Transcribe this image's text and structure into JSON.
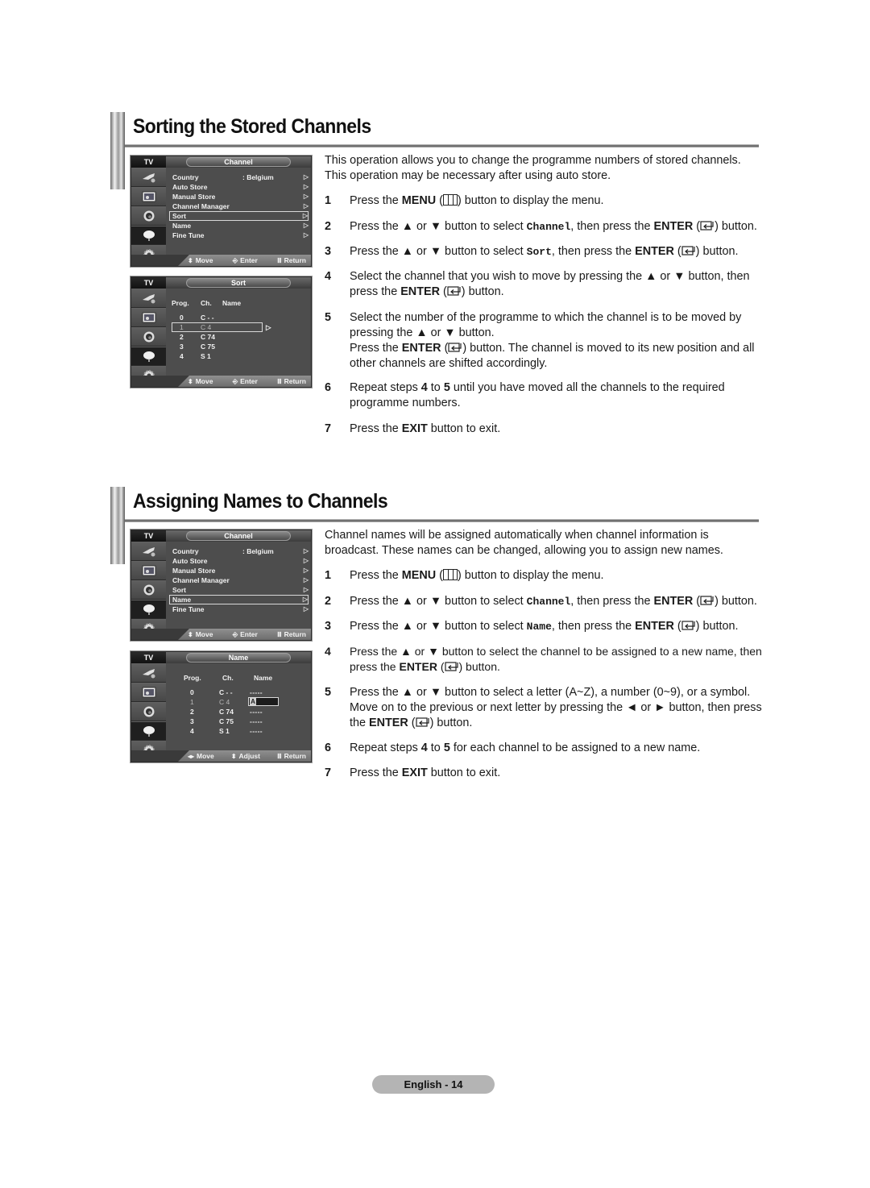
{
  "sections": [
    {
      "title": "Sorting the Stored Channels",
      "osd_channel_menu": {
        "tv_label": "TV",
        "title": "Channel",
        "items": [
          {
            "label": "Country",
            "value": ": Belgium"
          },
          {
            "label": "Auto Store",
            "value": ""
          },
          {
            "label": "Manual Store",
            "value": ""
          },
          {
            "label": "Channel Manager",
            "value": ""
          },
          {
            "label": "Sort",
            "value": "",
            "selected": true
          },
          {
            "label": "Name",
            "value": ""
          },
          {
            "label": "Fine Tune",
            "value": ""
          }
        ],
        "footer": [
          "Move",
          "Enter",
          "Return"
        ]
      },
      "osd_sub": {
        "tv_label": "TV",
        "title": "Sort",
        "headers": [
          "Prog.",
          "Ch.",
          "Name"
        ],
        "rows": [
          {
            "prog": "0",
            "ch": "C - -"
          },
          {
            "prog": "1",
            "ch": "C 4",
            "selected": true
          },
          {
            "prog": "2",
            "ch": "C 74"
          },
          {
            "prog": "3",
            "ch": "C 75"
          },
          {
            "prog": "4",
            "ch": "S 1"
          }
        ],
        "footer": [
          "Move",
          "Enter",
          "Return"
        ]
      },
      "intro": "This operation allows you to change the programme numbers of stored channels. This operation may be necessary after using auto store.",
      "steps": [
        {
          "num": "1",
          "parts": [
            "Press the ",
            "MENU",
            " (",
            ") button to display the menu."
          ]
        },
        {
          "num": "2",
          "parts": [
            "Press the ▲ or ▼ button to select ",
            "Channel",
            ", then press the ",
            "ENTER",
            " (",
            ") button."
          ]
        },
        {
          "num": "3",
          "parts": [
            "Press the ▲ or ▼ button to select ",
            "Sort",
            ", then press the ",
            "ENTER",
            " (",
            ") button."
          ]
        },
        {
          "num": "4",
          "parts": [
            "Select the channel that you wish to move by pressing the ▲ or ▼ button, then press the ",
            "ENTER",
            " (",
            ") button."
          ]
        },
        {
          "num": "5",
          "parts": [
            "Select the number of the programme to which the channel is to be moved by pressing the ▲ or ▼ button.",
            "Press the ",
            "ENTER",
            " (",
            ") button. The channel is moved to its new position and all other channels are shifted accordingly."
          ]
        },
        {
          "num": "6",
          "parts": [
            "Repeat steps ",
            "4",
            " to ",
            "5",
            " until you have moved all the channels to the required programme numbers."
          ]
        },
        {
          "num": "7",
          "parts": [
            "Press the ",
            "EXIT",
            " button to exit."
          ]
        }
      ]
    },
    {
      "title": "Assigning Names to Channels",
      "osd_channel_menu": {
        "tv_label": "TV",
        "title": "Channel",
        "items": [
          {
            "label": "Country",
            "value": ": Belgium"
          },
          {
            "label": "Auto Store",
            "value": ""
          },
          {
            "label": "Manual Store",
            "value": ""
          },
          {
            "label": "Channel Manager",
            "value": ""
          },
          {
            "label": "Sort",
            "value": ""
          },
          {
            "label": "Name",
            "value": "",
            "selected": true
          },
          {
            "label": "Fine Tune",
            "value": ""
          }
        ],
        "footer": [
          "Move",
          "Enter",
          "Return"
        ]
      },
      "osd_sub": {
        "tv_label": "TV",
        "title": "Name",
        "headers": [
          "Prog.",
          "Ch.",
          "Name"
        ],
        "rows": [
          {
            "prog": "0",
            "ch": "C - -",
            "name": "- - - - -"
          },
          {
            "prog": "1",
            "ch": "C 4",
            "name": "A",
            "selected": true
          },
          {
            "prog": "2",
            "ch": "C 74",
            "name": "- - - - -"
          },
          {
            "prog": "3",
            "ch": "C 75",
            "name": "- - - - -"
          },
          {
            "prog": "4",
            "ch": "S 1",
            "name": "- - - - -"
          }
        ],
        "footer": [
          "Move",
          "Adjust",
          "Return"
        ]
      },
      "intro": "Channel names will be assigned automatically when channel information is broadcast. These names can be changed, allowing you to assign new names.",
      "steps": [
        {
          "num": "1",
          "parts": [
            "Press the ",
            "MENU",
            " (",
            ") button to display the menu."
          ]
        },
        {
          "num": "2",
          "parts": [
            "Press the ▲ or ▼ button to select ",
            "Channel",
            ", then press the ",
            "ENTER",
            " (",
            ") button."
          ]
        },
        {
          "num": "3",
          "parts": [
            "Press the ▲ or ▼ button to select ",
            "Name",
            ", then press the ",
            "ENTER",
            " (",
            ") button."
          ]
        },
        {
          "num": "4",
          "parts": [
            "Press the ▲ or ▼ button to select the channel to be assigned to a new name, then press the ",
            "ENTER",
            " (",
            ") button."
          ]
        },
        {
          "num": "5",
          "parts": [
            "Press the ▲ or ▼ button to select a letter (A~Z), a number (0~9), or a symbol. Move on to the previous or next letter by pressing the ◄ or ► button, then press the ",
            "ENTER",
            " (",
            ") button."
          ]
        },
        {
          "num": "6",
          "parts": [
            "Repeat steps ",
            "4",
            " to ",
            "5",
            " for each channel to be assigned to a new name."
          ]
        },
        {
          "num": "7",
          "parts": [
            "Press the ",
            "EXIT",
            " button to exit."
          ]
        }
      ]
    }
  ],
  "icons": {
    "menu_sidebar": [
      "input-plug-icon",
      "picture-icon",
      "sound-icon",
      "channel-dish-icon",
      "setup-gear-icon"
    ],
    "footer_move": "up-down-arrows-icon",
    "footer_move_lr": "left-right-arrows-icon",
    "footer_enter": "enter-icon",
    "footer_return": "menu-return-icon"
  },
  "page_footer": "English - 14"
}
